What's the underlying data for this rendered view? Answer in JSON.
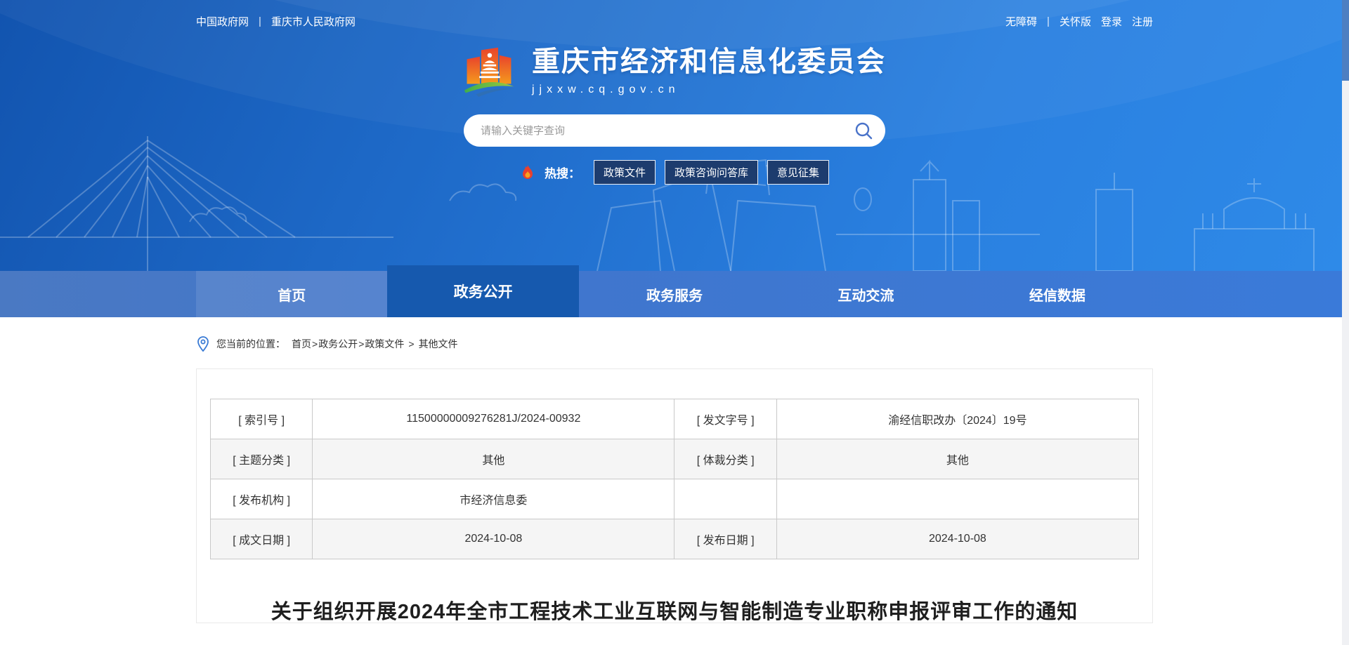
{
  "top_bar": {
    "left_links": [
      "中国政府网",
      "重庆市人民政府网"
    ],
    "right_links": [
      "无障碍",
      "关怀版",
      "登录",
      "注册"
    ],
    "divider": "|"
  },
  "header": {
    "site_title": "重庆市经济和信息化委员会",
    "site_url": "jjxxw.cq.gov.cn",
    "search_placeholder": "请输入关键字查询",
    "hot_label": "热搜：",
    "hot_links": [
      "政策文件",
      "政策咨询问答库",
      "意见征集"
    ]
  },
  "nav": {
    "items": [
      {
        "label": "首页",
        "active": false
      },
      {
        "label": "政务公开",
        "active": true
      },
      {
        "label": "政务服务",
        "active": false
      },
      {
        "label": "互动交流",
        "active": false
      },
      {
        "label": "经信数据",
        "active": false
      }
    ]
  },
  "breadcrumb": {
    "prefix": "您当前的位置：",
    "segments": [
      "首页",
      "政务公开",
      "政策文件",
      "其他文件"
    ],
    "separator": ">"
  },
  "doc_meta": {
    "rows": [
      {
        "label1": "[ 索引号 ]",
        "value1": "11500000009276281J/2024-00932",
        "label2": "[ 发文字号 ]",
        "value2": "渝经信职改办〔2024〕19号"
      },
      {
        "label1": "[ 主题分类 ]",
        "value1": "其他",
        "label2": "[ 体裁分类 ]",
        "value2": "其他"
      },
      {
        "label1": "[ 发布机构 ]",
        "value1": "市经济信息委",
        "label2": "",
        "value2": ""
      },
      {
        "label1": "[ 成文日期 ]",
        "value1": "2024-10-08",
        "label2": "[ 发布日期 ]",
        "value2": "2024-10-08"
      }
    ]
  },
  "article": {
    "title": "关于组织开展2024年全市工程技术工业互联网与智能制造专业职称申报评审工作的通知"
  },
  "icons": {
    "search": "magnifier",
    "flame": "flame",
    "location": "map-pin",
    "logo": "chongqing-gov-emblem"
  },
  "colors": {
    "header_blue_top": "#1254af",
    "header_blue_bottom": "#2e8ae8",
    "nav_blue": "#3f78d2",
    "nav_active": "#1659ae",
    "hot_button_navy": "#1d3c6e",
    "table_border": "#c9c9c9",
    "table_stripe": "#f5f5f5",
    "text_dark": "#1f1f1f"
  }
}
